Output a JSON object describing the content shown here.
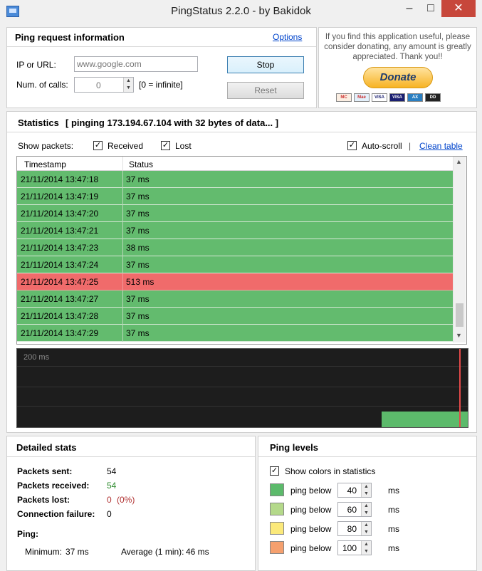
{
  "window": {
    "title": "PingStatus 2.2.0 - by Bakidok"
  },
  "ping_request": {
    "heading": "Ping request information",
    "options_link": "Options",
    "ip_label": "IP or URL:",
    "ip_placeholder": "www.google.com",
    "calls_label": "Num. of calls:",
    "calls_value": "0",
    "calls_hint": "[0 = infinite]",
    "stop_label": "Stop",
    "reset_label": "Reset"
  },
  "donate": {
    "text": "If you find this application useful, please consider donating, any amount is greatly appreciated. Thank you!!",
    "button": "Donate",
    "cards": [
      "MasterCard",
      "Maestro",
      "VISA",
      "VISA",
      "AMEX",
      "DIRECT"
    ]
  },
  "statistics": {
    "heading": "Statistics",
    "status": "[ pinging 173.194.67.104 with 32 bytes of data... ]",
    "show_packets_label": "Show packets:",
    "received_label": "Received",
    "lost_label": "Lost",
    "autoscroll_label": "Auto-scroll",
    "divider": "|",
    "clean_label": "Clean table",
    "columns": [
      "Timestamp",
      "Status"
    ],
    "rows": [
      {
        "timestamp": "21/11/2014  13:47:18",
        "status": "37 ms",
        "lost": false
      },
      {
        "timestamp": "21/11/2014  13:47:19",
        "status": "37 ms",
        "lost": false
      },
      {
        "timestamp": "21/11/2014  13:47:20",
        "status": "37 ms",
        "lost": false
      },
      {
        "timestamp": "21/11/2014  13:47:21",
        "status": "37 ms",
        "lost": false
      },
      {
        "timestamp": "21/11/2014  13:47:23",
        "status": "38 ms",
        "lost": false
      },
      {
        "timestamp": "21/11/2014  13:47:24",
        "status": "37 ms",
        "lost": false
      },
      {
        "timestamp": "21/11/2014  13:47:25",
        "status": "513 ms",
        "lost": true
      },
      {
        "timestamp": "21/11/2014  13:47:27",
        "status": "37 ms",
        "lost": false
      },
      {
        "timestamp": "21/11/2014  13:47:28",
        "status": "37 ms",
        "lost": false
      },
      {
        "timestamp": "21/11/2014  13:47:29",
        "status": "37 ms",
        "lost": false
      }
    ],
    "graph_label": "200 ms"
  },
  "detailed": {
    "heading": "Detailed stats",
    "sent_label": "Packets sent:",
    "sent_value": "54",
    "received_label": "Packets received:",
    "received_value": "54",
    "lost_label": "Packets lost:",
    "lost_value": "0",
    "lost_pct": "(0%)",
    "failure_label": "Connection failure:",
    "failure_value": "0",
    "ping_label": "Ping:",
    "min_label": "Minimum:",
    "min_value": "37 ms",
    "avg1_label": "Average (1 min):",
    "avg1_value": "46 ms"
  },
  "ping_levels": {
    "heading": "Ping levels",
    "show_colors_label": "Show colors in statistics",
    "levels": [
      {
        "label": "ping below",
        "value": "40",
        "unit": "ms",
        "color": "#5cba6b"
      },
      {
        "label": "ping below",
        "value": "60",
        "unit": "ms",
        "color": "#b4d98a"
      },
      {
        "label": "ping below",
        "value": "80",
        "unit": "ms",
        "color": "#fbe97a"
      },
      {
        "label": "ping below",
        "value": "100",
        "unit": "ms",
        "color": "#f5a06e"
      }
    ]
  },
  "colors": {
    "ok_row": "#63bb6e",
    "lost_row": "#f06b6b",
    "graph_bg": "#1d1d1d",
    "graph_fill": "#5cba6b"
  }
}
